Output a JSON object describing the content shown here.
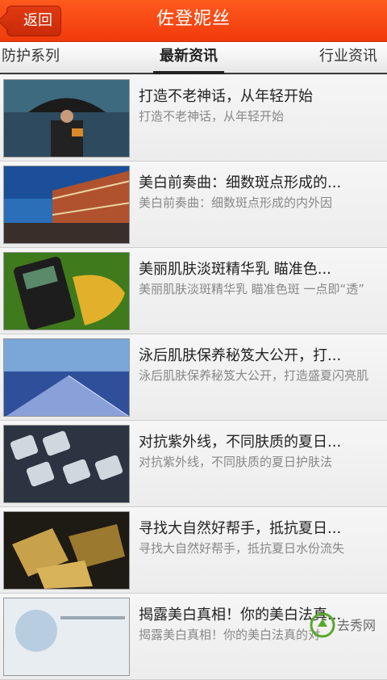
{
  "header": {
    "back_label": "返回",
    "title": "佐登妮丝"
  },
  "tabs": [
    {
      "label": "防护系列"
    },
    {
      "label": "最新资讯",
      "active": true
    },
    {
      "label": "行业资讯"
    }
  ],
  "articles": [
    {
      "title": "打造不老神话，从年轻开始",
      "summary": "打造不老神话，从年轻开始"
    },
    {
      "title": "美白前奏曲：细数斑点形成的...",
      "summary": "美白前奏曲：细数斑点形成的内外因"
    },
    {
      "title": "美丽肌肤淡斑精华乳 瞄准色...",
      "summary": "美丽肌肤淡斑精华乳 瞄准色斑 一点即“透”"
    },
    {
      "title": "泳后肌肤保养秘笈大公开，打...",
      "summary": "泳后肌肤保养秘笈大公开，打造盛夏闪亮肌"
    },
    {
      "title": "对抗紫外线，不同肤质的夏日...",
      "summary": "对抗紫外线，不同肤质的夏日护肤法"
    },
    {
      "title": "寻找大自然好帮手，抵抗夏日...",
      "summary": "寻找大自然好帮手，抵抗夏日水份流失"
    },
    {
      "title": "揭露美白真相！你的美白法真...",
      "summary": "揭露美白真相！你的美白法真的对"
    }
  ],
  "colors": {
    "header": "#f03a0b",
    "tab_indicator": "#222222",
    "title_text": "#222222",
    "summary_text": "#888888"
  },
  "watermark": {
    "text": "去秀网"
  }
}
